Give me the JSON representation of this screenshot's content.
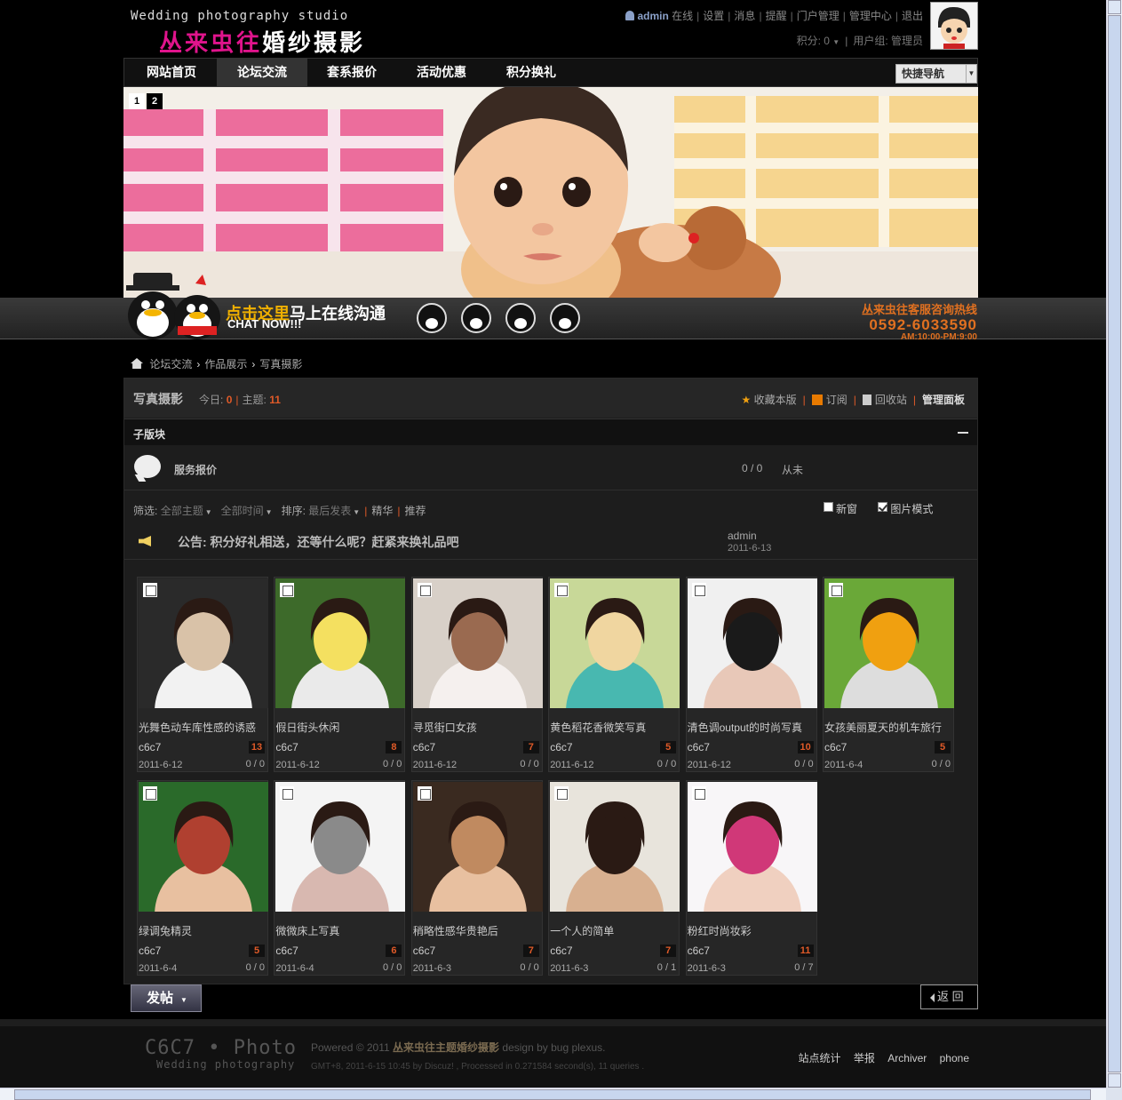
{
  "header": {
    "logo_en": "Wedding photography studio",
    "logo_cn_a": "丛来虫往",
    "logo_cn_b": "婚纱摄影",
    "user": "admin",
    "online": "在线",
    "links": [
      "设置",
      "消息",
      "提醒",
      "门户管理",
      "管理中心",
      "退出"
    ],
    "points": "积分: 0",
    "usergroup": "用户组: 管理员"
  },
  "nav": {
    "items": [
      "网站首页",
      "论坛交流",
      "套系报价",
      "活动优惠",
      "积分换礼"
    ],
    "active_index": 1,
    "quick_nav": "快捷导航"
  },
  "banner": {
    "slides": [
      "1",
      "2"
    ],
    "active_slide": 1
  },
  "chat": {
    "cta_a": "点击这里",
    "cta_b": "马上在线沟通",
    "cta_en": "CHAT NOW!!!",
    "hotline_title": "丛来虫往客服咨询热线",
    "hotline_number": "0592-6033590",
    "hours": "AM:10:00-PM:9:00",
    "hotline_color": "#e07020"
  },
  "breadcrumb": [
    "论坛交流",
    "作品展示",
    "写真摄影"
  ],
  "board": {
    "title": "写真摄影",
    "today_label": "今日:",
    "today": "0",
    "topics_label": "主题:",
    "topics": "11",
    "favorite": "收藏本版",
    "subscribe": "订阅",
    "recycle": "回收站",
    "admin_panel": "管理面板",
    "subforum_header": "子版块",
    "subforum": {
      "name": "服务报价",
      "count": "0 / 0",
      "last": "从未"
    },
    "filters": {
      "label": "筛选:",
      "all_topics": "全部主题",
      "all_time": "全部时间",
      "sort_label": "排序:",
      "sort": "最后发表",
      "digest": "精华",
      "recommend": "推荐"
    },
    "options": {
      "new_window": "新窗",
      "new_window_checked": false,
      "image_mode": "图片模式",
      "image_mode_checked": true
    },
    "notice": {
      "text": "公告: 积分好礼相送，还等什么呢？赶紧来换礼品吧",
      "author": "admin",
      "date": "2011-6-13"
    },
    "accent": "#e05a28"
  },
  "threads": [
    {
      "title": "光舞色动车库性感的诱惑",
      "author": "c6c7",
      "views": "13",
      "date": "2011-6-12",
      "replies": "0 / 0"
    },
    {
      "title": "假日街头休闲",
      "author": "c6c7",
      "views": "8",
      "date": "2011-6-12",
      "replies": "0 / 0"
    },
    {
      "title": "寻觅街口女孩",
      "author": "c6c7",
      "views": "7",
      "date": "2011-6-12",
      "replies": "0 / 0"
    },
    {
      "title": "黄色稻花香微笑写真",
      "author": "c6c7",
      "views": "5",
      "date": "2011-6-12",
      "replies": "0 / 0"
    },
    {
      "title": "清色调output的时尚写真",
      "author": "c6c7",
      "views": "10",
      "date": "2011-6-12",
      "replies": "0 / 0"
    },
    {
      "title": "女孩美丽夏天的机车旅行",
      "author": "c6c7",
      "views": "5",
      "date": "2011-6-4",
      "replies": "0 / 0"
    },
    {
      "title": "绿调兔精灵",
      "author": "c6c7",
      "views": "5",
      "date": "2011-6-4",
      "replies": "0 / 0"
    },
    {
      "title": "微微床上写真",
      "author": "c6c7",
      "views": "6",
      "date": "2011-6-4",
      "replies": "0 / 0"
    },
    {
      "title": "稍略性感华贵艳后",
      "author": "c6c7",
      "views": "7",
      "date": "2011-6-3",
      "replies": "0 / 0"
    },
    {
      "title": "一个人的简单",
      "author": "c6c7",
      "views": "7",
      "date": "2011-6-3",
      "replies": "0 / 1"
    },
    {
      "title": "粉红时尚妆彩",
      "author": "c6c7",
      "views": "11",
      "date": "2011-6-3",
      "replies": "0 / 7"
    }
  ],
  "actions": {
    "post": "发帖",
    "back": "返 回"
  },
  "footer": {
    "logo": "C6C7 • Photo",
    "logo_sub": "Wedding photography",
    "powered_a": "Powered © 2011",
    "powered_name": "丛来虫往主题婚纱摄影",
    "powered_b": "design by bug plexus.",
    "info": "GMT+8, 2011-6-15 10:45 by Discuz! , Processed in 0.271584 second(s), 11 queries .",
    "links": [
      "站点统计",
      "举报",
      "Archiver",
      "phone"
    ]
  }
}
